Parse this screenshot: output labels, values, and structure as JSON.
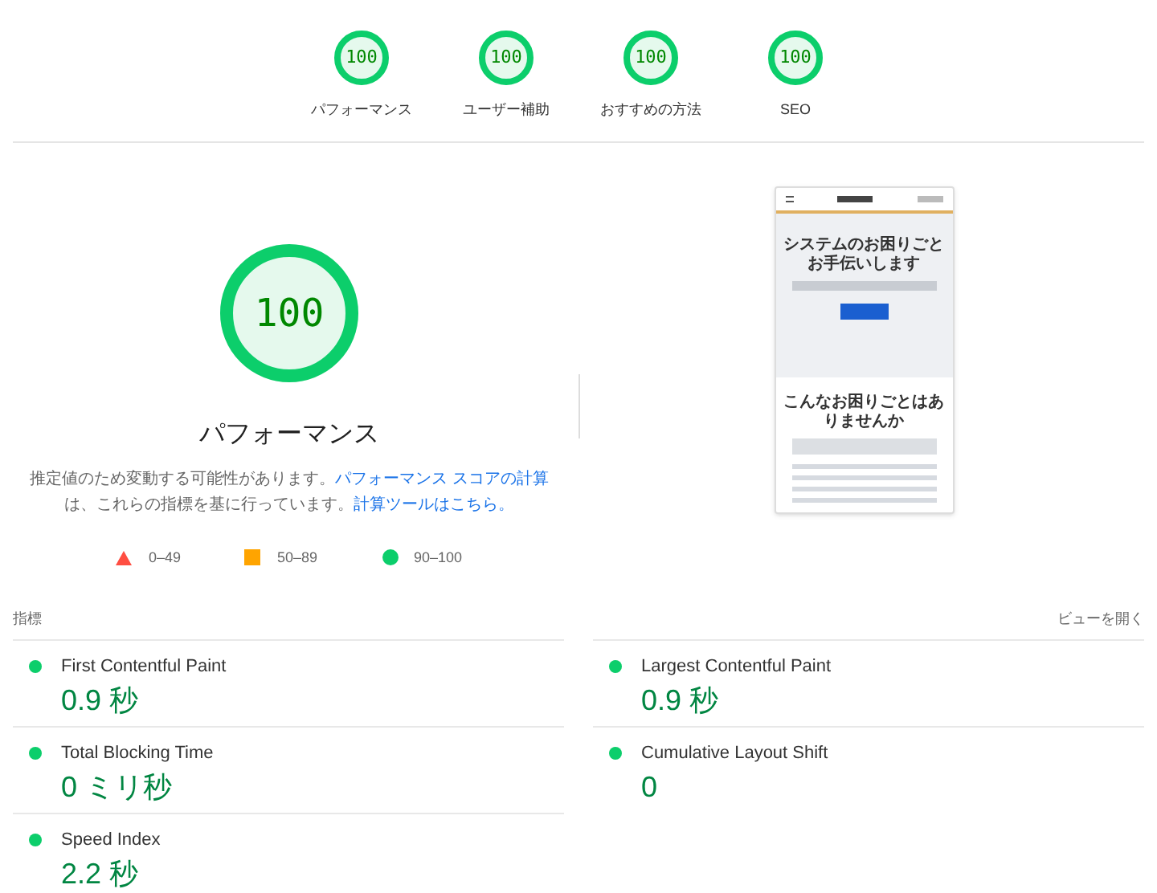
{
  "categories": [
    {
      "score": "100",
      "label": "パフォーマンス"
    },
    {
      "score": "100",
      "label": "ユーザー補助"
    },
    {
      "score": "100",
      "label": "おすすめの方法"
    },
    {
      "score": "100",
      "label": "SEO"
    }
  ],
  "main": {
    "score": "100",
    "title": "パフォーマンス",
    "description_parts": [
      {
        "kind": "text",
        "text": "推定値のため変動する可能性があります。"
      },
      {
        "kind": "link",
        "text": "パフォーマンス スコアの計算"
      },
      {
        "kind": "text",
        "text": "は、これらの指標を基に行っています。"
      },
      {
        "kind": "link",
        "text": "計算ツールはこちら。"
      }
    ]
  },
  "legend": [
    {
      "kind": "fail",
      "label": "0–49"
    },
    {
      "kind": "average",
      "label": "50–89"
    },
    {
      "kind": "pass",
      "label": "90–100"
    }
  ],
  "screenshot": {
    "hero_title": "システムのお困りごとお手伝いします",
    "section_title": "こんなお困りごとはありませんか"
  },
  "metrics_header": {
    "title": "指標",
    "toggle": "ビューを開く"
  },
  "metrics": [
    {
      "name": "First Contentful Paint",
      "value": "0.9 秒",
      "color": "#0cce6b"
    },
    {
      "name": "Largest Contentful Paint",
      "value": "0.9 秒",
      "color": "#0cce6b"
    },
    {
      "name": "Total Blocking Time",
      "value": "0 ミリ秒",
      "color": "#0cce6b"
    },
    {
      "name": "Cumulative Layout Shift",
      "value": "0",
      "color": "#0cce6b"
    },
    {
      "name": "Speed Index",
      "value": "2.2 秒",
      "color": "#0cce6b"
    }
  ]
}
